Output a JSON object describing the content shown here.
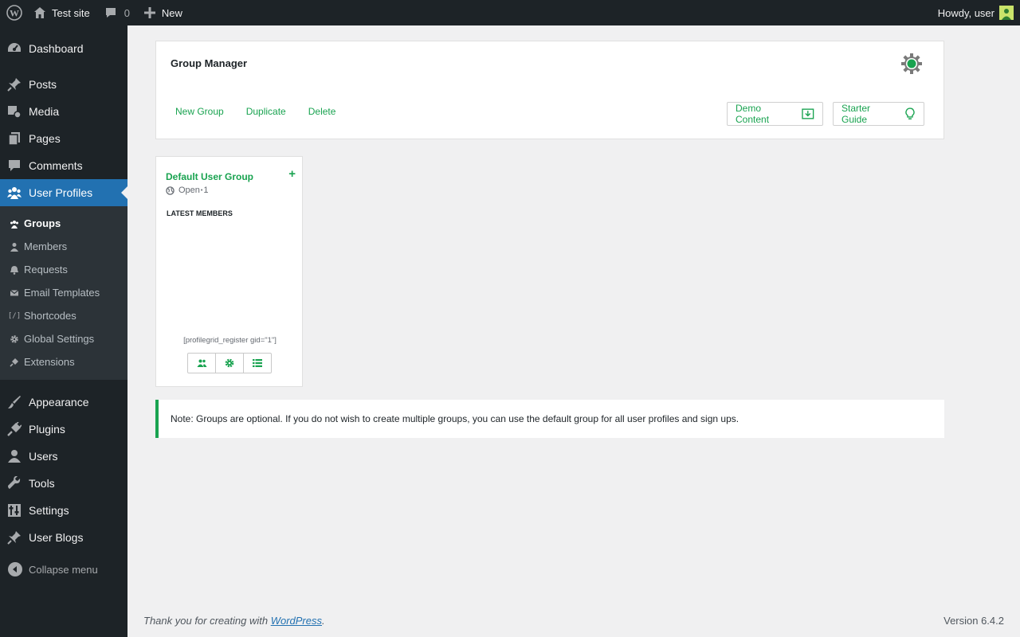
{
  "adminbar": {
    "site_name": "Test site",
    "comments_count": "0",
    "new_label": "New",
    "greeting": "Howdy, user"
  },
  "sidebar": {
    "items_top": [
      {
        "label": "Dashboard",
        "icon": "dashboard-icon"
      },
      {
        "label": "Posts",
        "icon": "pin-icon"
      },
      {
        "label": "Media",
        "icon": "media-icon"
      },
      {
        "label": "Pages",
        "icon": "pages-icon"
      },
      {
        "label": "Comments",
        "icon": "comment-icon"
      },
      {
        "label": "User Profiles",
        "icon": "users-group-icon"
      }
    ],
    "submenu": [
      {
        "label": "Groups",
        "icon": "groups-icon"
      },
      {
        "label": "Members",
        "icon": "person-icon"
      },
      {
        "label": "Requests",
        "icon": "bell-icon"
      },
      {
        "label": "Email Templates",
        "icon": "envelope-icon"
      },
      {
        "label": "Shortcodes",
        "icon": "shortcode-icon"
      },
      {
        "label": "Global Settings",
        "icon": "gear-icon"
      },
      {
        "label": "Extensions",
        "icon": "plugin-icon"
      }
    ],
    "items_bottom": [
      {
        "label": "Appearance",
        "icon": "brush-icon"
      },
      {
        "label": "Plugins",
        "icon": "plugin-icon"
      },
      {
        "label": "Users",
        "icon": "user-icon"
      },
      {
        "label": "Tools",
        "icon": "wrench-icon"
      },
      {
        "label": "Settings",
        "icon": "settings-icon"
      },
      {
        "label": "User Blogs",
        "icon": "pin-icon"
      }
    ],
    "collapse_label": "Collapse menu"
  },
  "panel": {
    "title": "Group Manager",
    "actions": [
      "New Group",
      "Duplicate",
      "Delete"
    ],
    "demo_label": "Demo Content",
    "guide_label": "Starter Guide"
  },
  "card": {
    "title": "Default User Group",
    "status": "Open",
    "separator": "•",
    "member_count": "1",
    "latest_label": "LATEST MEMBERS",
    "shortcode": "[profilegrid_register gid=\"1\"]"
  },
  "note": "Note: Groups are optional. If you do not wish to create multiple groups, you can use the default group for all user profiles and sign ups.",
  "footer": {
    "thanks_prefix": "Thank you for creating with ",
    "thanks_link": "WordPress",
    "thanks_suffix": ".",
    "version": "Version 6.4.2"
  },
  "colors": {
    "accent": "#19a350",
    "wp_blue": "#2271b1",
    "adminbar_bg": "#1d2327"
  }
}
